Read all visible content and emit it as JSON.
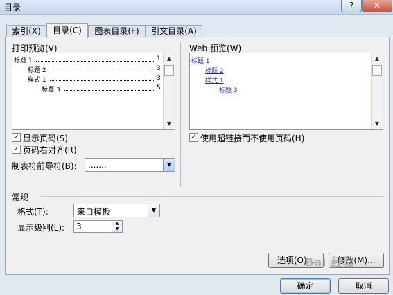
{
  "window": {
    "title": "目录",
    "help": "?",
    "close": "✕"
  },
  "tabs": [
    {
      "label": "索引",
      "key": "(X)"
    },
    {
      "label": "目录",
      "key": "(C)"
    },
    {
      "label": "图表目录",
      "key": "(F)"
    },
    {
      "label": "引文目录",
      "key": "(A)"
    }
  ],
  "print_preview": {
    "label": "打印预览(V)",
    "entries": [
      {
        "text": "标题 1",
        "page": "1"
      },
      {
        "text": "标题 2",
        "page": "3"
      },
      {
        "text": "样式 1",
        "page": "3"
      },
      {
        "text": "标题 3",
        "page": "5"
      }
    ]
  },
  "web_preview": {
    "label": "Web 预览(W)",
    "entries": [
      "标题 1",
      "标题 2",
      "样式 1",
      "标题 3"
    ]
  },
  "options": {
    "show_page_numbers": "显示页码(S)",
    "right_align": "页码右对齐(R)",
    "tab_leader_label": "制表符前导符(B):",
    "tab_leader_value": ".......",
    "use_hyperlinks": "使用超链接而不使用页码(H)"
  },
  "general": {
    "section_label": "常规",
    "format_label": "格式(T):",
    "format_value": "来自模板",
    "levels_label": "显示级别(L):",
    "levels_value": "3"
  },
  "buttons": {
    "options": "选项(O)...",
    "modify": "修改(M)...",
    "ok": "确定",
    "cancel": "取消"
  },
  "watermark": "Bai 经验"
}
